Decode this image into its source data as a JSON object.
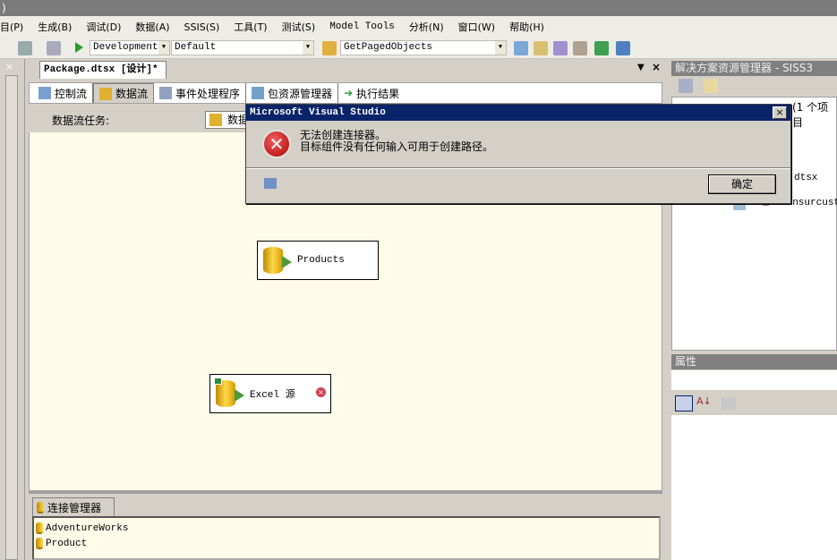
{
  "titlebar": {
    "text": ")"
  },
  "menu": [
    "目(P)",
    "生成(B)",
    "调试(D)",
    "数据(A)",
    "SSIS(S)",
    "工具(T)",
    "测试(S)",
    "Model Tools",
    "分析(N)",
    "窗口(W)",
    "帮助(H)"
  ],
  "toolbar": {
    "config": "Development",
    "platform": "Default",
    "target": "GetPagedObjects"
  },
  "document": {
    "tab_title": "Package.dtsx [设计]*",
    "tabs": [
      "控制流",
      "数据流",
      "事件处理程序",
      "包资源管理器",
      "执行结果"
    ],
    "task_label": "数据流任务:",
    "task_value": "数据"
  },
  "canvas": {
    "components": [
      {
        "name": "Products"
      },
      {
        "name": "Excel 源"
      }
    ]
  },
  "connection_manager": {
    "tab": "连接管理器",
    "items": [
      "AdventureWorks",
      "Product"
    ]
  },
  "solution_explorer": {
    "title": "解决方案资源管理器 - SISS3",
    "items": [
      "(1 个项目",
      "dtsx",
      "ob_newinsurcustE"
    ]
  },
  "properties": {
    "title": "属性"
  },
  "dialog": {
    "title": "Microsoft Visual Studio",
    "line1": "无法创建连接器。",
    "line2": "目标组件没有任何输入可用于创建路径。",
    "ok": "确定",
    "close": "×"
  }
}
